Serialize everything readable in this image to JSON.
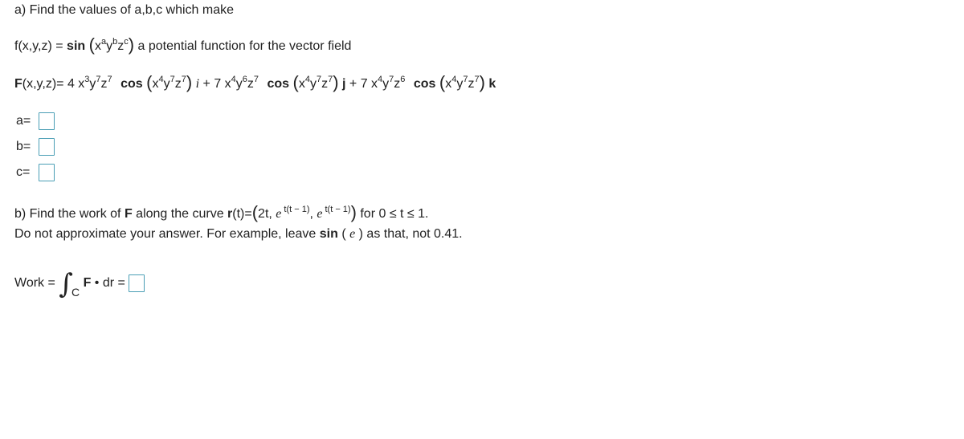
{
  "part_a": {
    "intro": "a) Find the values of a,b,c which make",
    "f_def": {
      "lhs": "f(x,y,z) = ",
      "func": "sin",
      "base_x": "x",
      "exp_a": "a",
      "base_y": "y",
      "exp_b": "b",
      "base_z": "z",
      "exp_c": "c",
      "suffix": " a potential function for the vector field"
    },
    "F_def": {
      "F": "F",
      "lhs_rest": "(x,y,z)= ",
      "i_term": {
        "coef": "4 x",
        "ex": "3",
        "y": "y",
        "ey": "7",
        "z": "z",
        "ez": "7",
        "func": "cos",
        "unit": "i",
        "sep": " + "
      },
      "j_term": {
        "coef": "7 x",
        "ex": "4",
        "y": "y",
        "ey": "6",
        "z": "z",
        "ez": "7",
        "func": "cos",
        "unit": "j",
        "sep": " + "
      },
      "k_term": {
        "coef": "7 x",
        "ex": "4",
        "y": "y",
        "ey": "7",
        "z": "z",
        "ez": "6",
        "func": "cos",
        "unit": "k"
      },
      "arg": {
        "x": "x",
        "ex": "4",
        "y": "y",
        "ey": "7",
        "z": "z",
        "ez": "7"
      }
    },
    "answers": [
      {
        "label": "a=",
        "value": ""
      },
      {
        "label": "b=",
        "value": ""
      },
      {
        "label": "c=",
        "value": ""
      }
    ]
  },
  "part_b": {
    "line1_pre": "b) Find the work of ",
    "F": "F",
    "line1_mid": " along the curve ",
    "r": "r",
    "line1_r_rest": "(t)=",
    "comp1": "2t, ",
    "e": "e",
    "exp": "t(t − 1)",
    "comma": ", ",
    "range": " for 0 ≤ t ≤ 1.",
    "line2_pre": "Do not approximate your answer. For example, leave ",
    "sin": "sin",
    "e_paren_open": " ( ",
    "e_paren_close": " ) as that, not 0.41.",
    "work_label": "Work = ",
    "integral": "∫",
    "sub": "C",
    "integrand_F": "F",
    "dot": " • ",
    "dr": "dr",
    "equals": " = ",
    "answer": ""
  }
}
